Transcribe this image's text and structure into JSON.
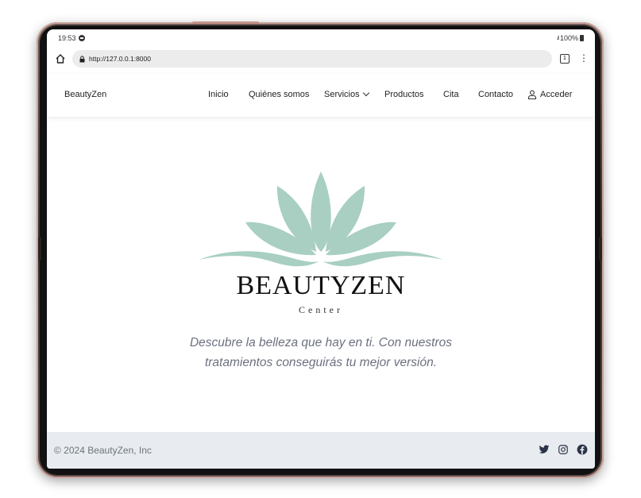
{
  "status_bar": {
    "time": "19:53",
    "battery": "100%"
  },
  "browser": {
    "url": "http://127.0.0.1:8000",
    "tab_count": "1",
    "menu_glyph": "⋮"
  },
  "navbar": {
    "brand": "BeautyZen",
    "items": [
      "Inicio",
      "Quiénes somos",
      "Servicios",
      "Productos",
      "Cita",
      "Contacto",
      "Acceder"
    ]
  },
  "hero": {
    "wordmark": "BEAUTYZEN",
    "wordmark_sub": "Center",
    "tagline": "Descubre la belleza que hay en ti. Con nuestros tratamientos conseguirás tu mejor versión."
  },
  "footer": {
    "copyright": "© 2024 BeautyZen, Inc",
    "social_icons": [
      "twitter-icon",
      "instagram-icon",
      "facebook-icon"
    ]
  },
  "colors": {
    "lotus": "#a8cfc2",
    "footer_bg": "#e8ebef",
    "muted_text": "#6c7080"
  }
}
